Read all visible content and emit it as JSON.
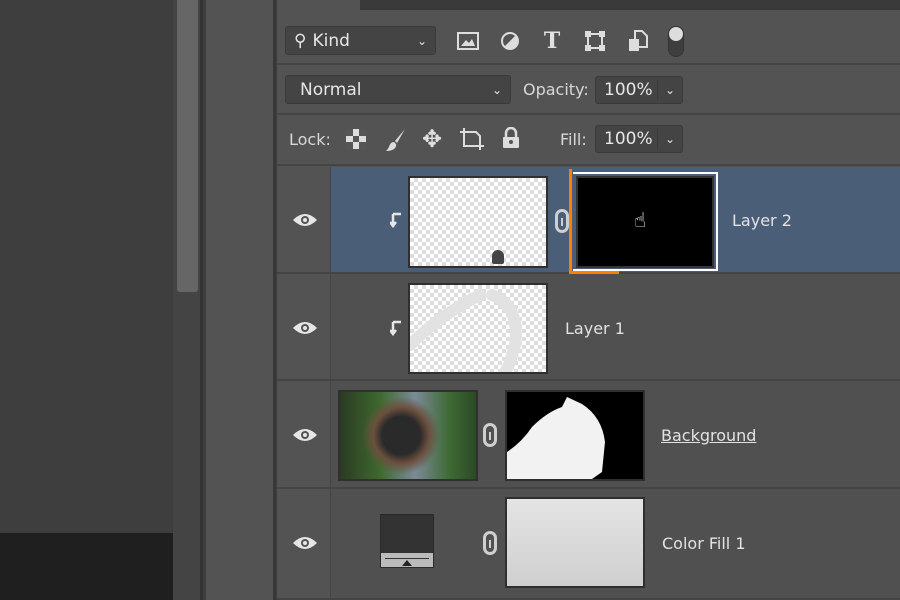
{
  "filter": {
    "kind_label": "Kind",
    "icons": [
      "search-icon",
      "image-filter-icon",
      "adjustment-filter-icon",
      "type-filter-icon",
      "shape-filter-icon",
      "smart-object-filter-icon",
      "filter-toggle"
    ]
  },
  "blend": {
    "mode": "Normal",
    "opacity_label": "Opacity:",
    "opacity_value": "100%"
  },
  "lock": {
    "label": "Lock:",
    "fill_label": "Fill:",
    "fill_value": "100%",
    "icons": [
      "lock-transparent-icon",
      "lock-image-icon",
      "lock-position-icon",
      "lock-artboard-icon",
      "lock-all-icon"
    ]
  },
  "layers": [
    {
      "name": "Layer 2",
      "selected": true,
      "clipped": true,
      "visible": true
    },
    {
      "name": "Layer 1",
      "selected": false,
      "clipped": true,
      "visible": true
    },
    {
      "name": "Background",
      "selected": false,
      "clipped": false,
      "visible": true
    },
    {
      "name": "Color Fill 1",
      "selected": false,
      "clipped": false,
      "visible": true
    }
  ],
  "colors": {
    "selection": "#4b5e78",
    "mask_highlight": "#ff7f00"
  }
}
